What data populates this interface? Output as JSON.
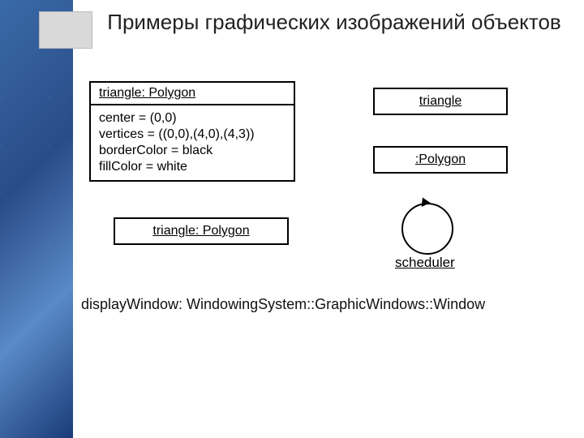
{
  "title": "Примеры графических изображений объектов",
  "fullObject": {
    "name": "triangle: Polygon",
    "attrs": [
      "center = (0,0)",
      "vertices = ((0,0),(4,0),(4,3))",
      "borderColor = black",
      "fillColor = white"
    ]
  },
  "nameClassBox": {
    "label": "triangle: Polygon"
  },
  "nameOnlyBox": {
    "label": "triangle"
  },
  "classOnlyBox": {
    "label": ":Polygon"
  },
  "scheduler": {
    "label": "scheduler"
  },
  "qualified": {
    "label": "displayWindow: WindowingSystem::GraphicWindows::Window"
  }
}
